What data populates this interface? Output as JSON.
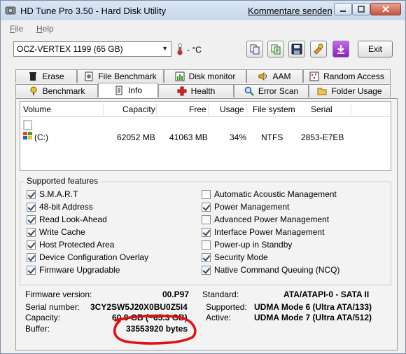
{
  "window": {
    "title": "HD Tune Pro 3.50 - Hard Disk Utility",
    "comment_link": "Kommentare senden",
    "minimize_icon": "minimize-icon",
    "maximize_icon": "maximize-icon",
    "close_icon": "close-icon"
  },
  "menu": {
    "file": "File",
    "help": "Help"
  },
  "toolbar": {
    "drive": "OCZ-VERTEX 1199 (65 GB)",
    "temperature": "- °C",
    "exit_label": "Exit",
    "icons": [
      "copy-icon",
      "copy-text-icon",
      "save-icon",
      "options-icon",
      "download-icon"
    ]
  },
  "tabs": {
    "row1": [
      "Erase",
      "File Benchmark",
      "Disk monitor",
      "AAM",
      "Random Access"
    ],
    "row2": [
      "Benchmark",
      "Info",
      "Health",
      "Error Scan",
      "Folder Usage"
    ],
    "active": "Info"
  },
  "volumes": {
    "headers": [
      "Volume",
      "Capacity",
      "Free",
      "Usage",
      "File system",
      "Serial"
    ],
    "rows": [
      {
        "volume": "(C:)",
        "capacity": "62052 MB",
        "free": "41063 MB",
        "usage": "34%",
        "fs": "NTFS",
        "serial": "2853-E7EB"
      }
    ]
  },
  "features": {
    "title": "Supported features",
    "left": [
      {
        "label": "S.M.A.R.T",
        "checked": true
      },
      {
        "label": "48-bit Address",
        "checked": true
      },
      {
        "label": "Read Look-Ahead",
        "checked": true
      },
      {
        "label": "Write Cache",
        "checked": true
      },
      {
        "label": "Host Protected Area",
        "checked": true
      },
      {
        "label": "Device Configuration Overlay",
        "checked": true
      },
      {
        "label": "Firmware Upgradable",
        "checked": true
      }
    ],
    "right": [
      {
        "label": "Automatic Acoustic Management",
        "checked": false
      },
      {
        "label": "Power Management",
        "checked": true
      },
      {
        "label": "Advanced Power Management",
        "checked": false
      },
      {
        "label": "Interface Power Management",
        "checked": true
      },
      {
        "label": "Power-up in Standby",
        "checked": false
      },
      {
        "label": "Security Mode",
        "checked": true
      },
      {
        "label": "Native Command Queuing (NCQ)",
        "checked": true
      }
    ]
  },
  "info": {
    "firmware_label": "Firmware version:",
    "firmware_value": "00.P97",
    "serial_label": "Serial number:",
    "serial_value": "3CY2SW5J20X0BU0Z5I4",
    "capacity_label": "Capacity:",
    "capacity_value": "60.8 GB (~65.3 GB)",
    "buffer_label": "Buffer:",
    "buffer_value": "33553920 bytes",
    "standard_label": "Standard:",
    "standard_value": "ATA/ATAPI-0 - SATA II",
    "supported_label": "Supported:",
    "supported_value": "UDMA Mode 6 (Ultra ATA/133)",
    "active_label": "Active:",
    "active_value": "UDMA Mode 7 (Ultra ATA/512)"
  },
  "colors": {
    "highlight_circle": "#e01010"
  }
}
